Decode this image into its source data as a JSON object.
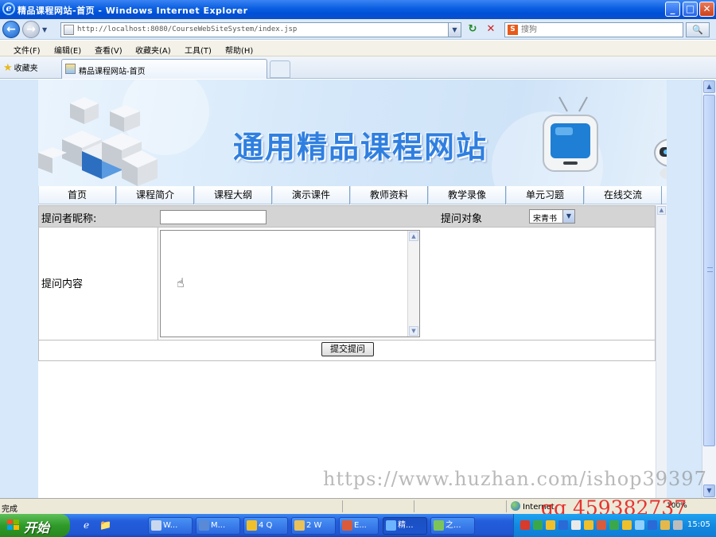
{
  "window": {
    "title": "精品课程网站-首页 - Windows Internet Explorer",
    "controls": {
      "minimize": "_",
      "maximize": "□",
      "close": "✕"
    }
  },
  "address_bar": {
    "url": "http://localhost:8080/CourseWebSiteSystem/index.jsp",
    "search_placeholder": "搜狗",
    "search_engine_icon": "S"
  },
  "menu": [
    "文件(F)",
    "编辑(E)",
    "查看(V)",
    "收藏夹(A)",
    "工具(T)",
    "帮助(H)"
  ],
  "favorites": {
    "label": "收藏夹"
  },
  "tab": {
    "title": "精品课程网站-首页"
  },
  "page": {
    "banner_title": "通用精品课程网站",
    "nav": [
      "首页",
      "课程简介",
      "课程大纲",
      "演示课件",
      "教师资料",
      "教学录像",
      "单元习题",
      "在线交流"
    ],
    "form": {
      "nickname_label": "提问者昵称:",
      "nickname_value": "",
      "target_label": "提问对象",
      "target_selected": "宋青书",
      "content_label": "提问内容",
      "content_value": "",
      "submit_label": "提交提问"
    }
  },
  "watermarks": {
    "url": "https://www.huzhan.com/ishop39397",
    "qq": "qq 459382737"
  },
  "status_bar": {
    "status": "完成",
    "zone": "Internet",
    "zoom": "100%"
  },
  "taskbar": {
    "start_label": "开始",
    "buttons": [
      "W...",
      "M...",
      "4 Q",
      "2 W",
      "E...",
      "精...",
      "之..."
    ],
    "clock": "15:05"
  },
  "colors": {
    "title_bar": "#0a5ee0",
    "banner_text": "#2f7fe0",
    "taskbar": "#245edc",
    "start_button": "#2f9b2a",
    "watermark_qq": "#e61414"
  }
}
